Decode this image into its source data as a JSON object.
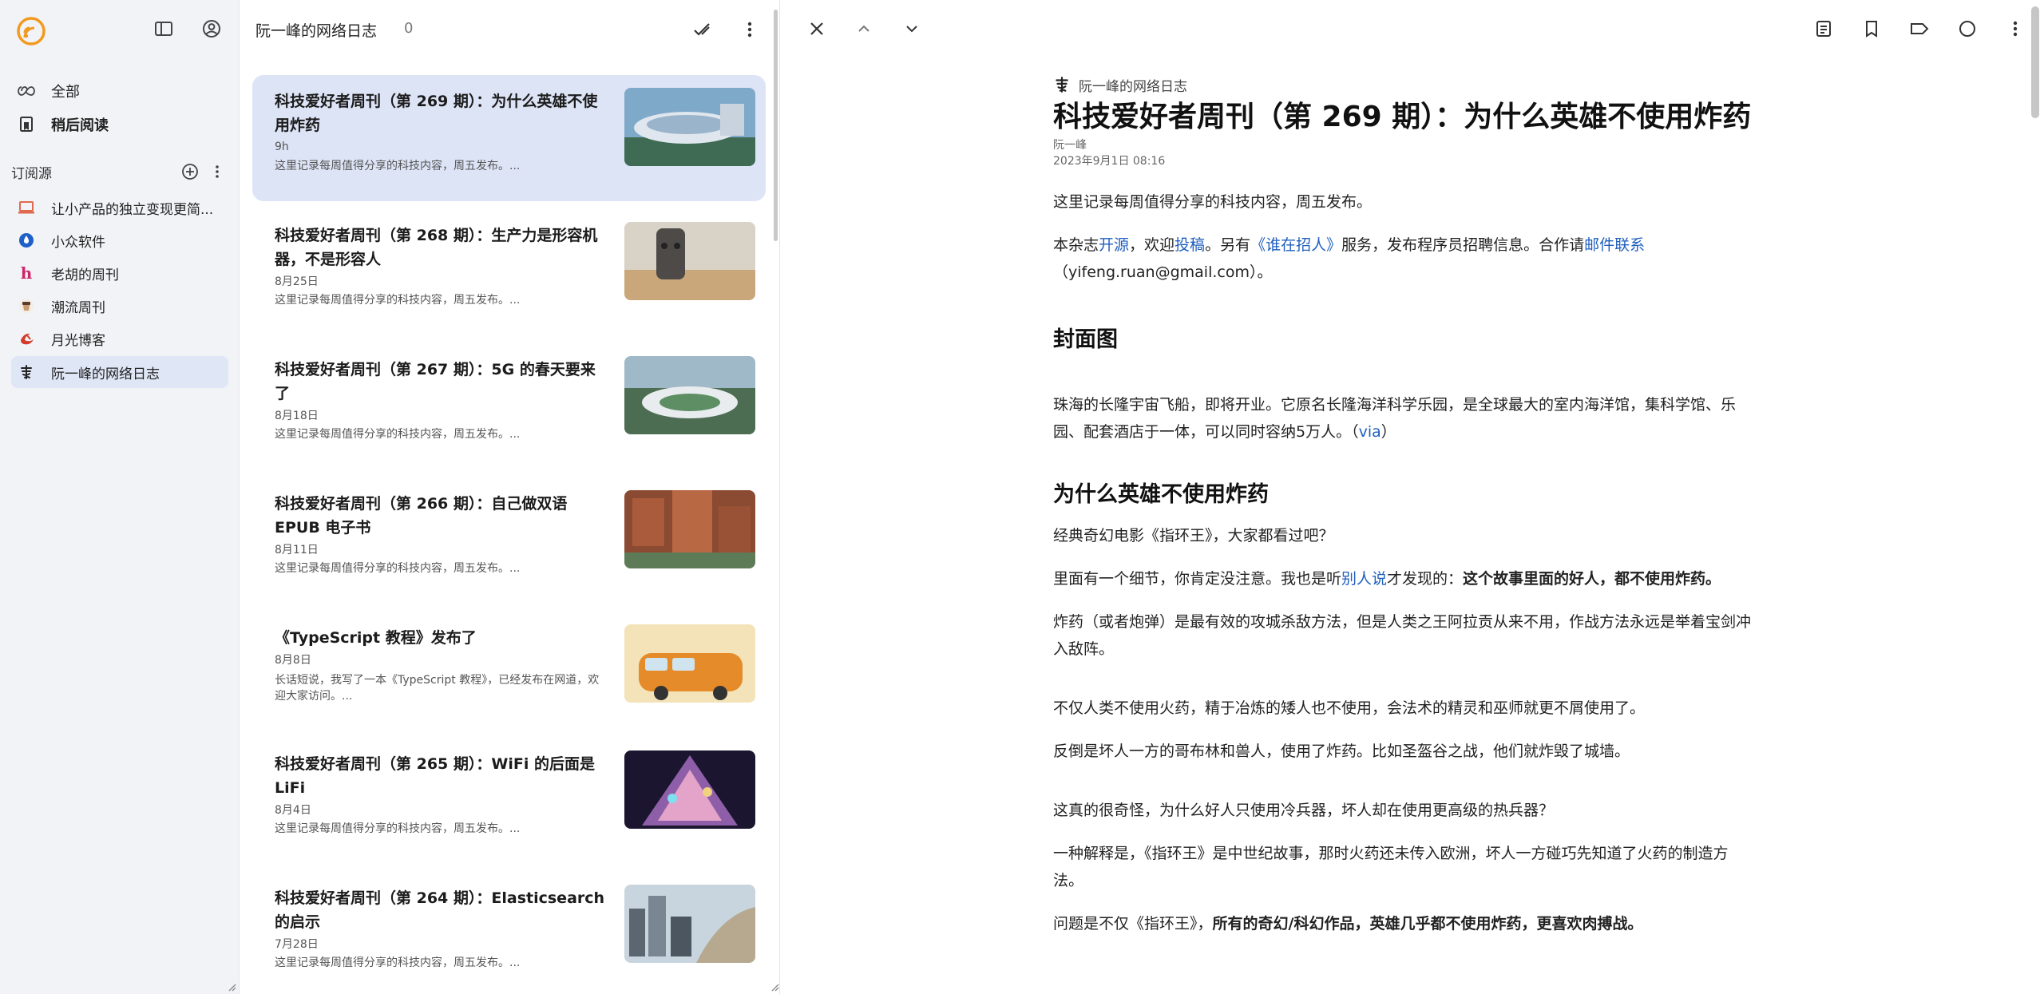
{
  "sidebar": {
    "nav": [
      {
        "label": "全部",
        "icon": "infinity-icon"
      },
      {
        "label": "稍后阅读",
        "icon": "read-later-icon"
      }
    ],
    "section_label": "订阅源",
    "feeds": [
      {
        "label": "让小产品的独立变现更简...",
        "icon": "laptop-favicon"
      },
      {
        "label": "小众软件",
        "icon": "drop-favicon"
      },
      {
        "label": "老胡的周刊",
        "icon": "h-favicon"
      },
      {
        "label": "潮流周刊",
        "icon": "cup-favicon"
      },
      {
        "label": "月光博客",
        "icon": "moon-favicon"
      },
      {
        "label": "阮一峰的网络日志",
        "icon": "calligraphy-favicon"
      }
    ]
  },
  "list": {
    "title": "阮一峰的网络日志",
    "count": "0",
    "cards": [
      {
        "title": "科技爱好者周刊（第 269 期）：为什么英雄不使用炸药",
        "date": "9h",
        "snippet": "这里记录每周值得分享的科技内容，周五发布。..."
      },
      {
        "title": "科技爱好者周刊（第 268 期）：生产力是形容机器，不是形容人",
        "date": "8月25日",
        "snippet": "这里记录每周值得分享的科技内容，周五发布。..."
      },
      {
        "title": "科技爱好者周刊（第 267 期）：5G 的春天要来了",
        "date": "8月18日",
        "snippet": "这里记录每周值得分享的科技内容，周五发布。..."
      },
      {
        "title": "科技爱好者周刊（第 266 期）：自己做双语 EPUB 电子书",
        "date": "8月11日",
        "snippet": "这里记录每周值得分享的科技内容，周五发布。..."
      },
      {
        "title": "《TypeScript 教程》发布了",
        "date": "8月8日",
        "snippet": "长话短说，我写了一本《TypeScript 教程》，已经发布在网道，欢迎大家访问。..."
      },
      {
        "title": "科技爱好者周刊（第 265 期）：WiFi 的后面是 LiFi",
        "date": "8月4日",
        "snippet": "这里记录每周值得分享的科技内容，周五发布。..."
      },
      {
        "title": "科技爱好者周刊（第 264 期）：Elasticsearch 的启示",
        "date": "7月28日",
        "snippet": "这里记录每周值得分享的科技内容，周五发布。..."
      }
    ]
  },
  "article": {
    "source": "阮一峰的网络日志",
    "title": "科技爱好者周刊（第 269 期）：为什么英雄不使用炸药",
    "author": "阮一峰",
    "datetime": "2023年9月1日 08:16",
    "p1": "这里记录每周值得分享的科技内容，周五发布。",
    "p2": {
      "t1": "本杂志",
      "l1": "开源",
      "t2": "，欢迎",
      "l2": "投稿",
      "t3": "。另有",
      "l3": "《谁在招人》",
      "t4": "服务，发布程序员招聘信息。合作请",
      "l4": "邮件联系",
      "t5": "（yifeng.ruan@gmail.com）。"
    },
    "h_cover": "封面图",
    "p3": "珠海的长隆宇宙飞船，即将开业。它原名长隆海洋科学乐园，是全球最大的室内海洋馆，集科学馆、乐园、配套酒店于一体，可以同时容纳5万人。（",
    "p3_link": "via",
    "p3_end": "）",
    "h_main": "为什么英雄不使用炸药",
    "p4": "经典奇幻电影《指环王》，大家都看过吧？",
    "p5": {
      "t1": "里面有一个细节，你肯定没注意。我也是听",
      "l1": "别人说",
      "t2": "才发现的：",
      "b1": "这个故事里面的好人，都不使用炸药。"
    },
    "p6": "炸药（或者炮弹）是最有效的攻城杀敌方法，但是人类之王阿拉贡从来不用，作战方法永远是举着宝剑冲入敌阵。",
    "p7": "不仅人类不使用火药，精于冶炼的矮人也不使用，会法术的精灵和巫师就更不屑使用了。",
    "p8": "反倒是坏人一方的哥布林和兽人，使用了炸药。比如圣盔谷之战，他们就炸毁了城墙。",
    "p9": "这真的很奇怪，为什么好人只使用冷兵器，坏人却在使用更高级的热兵器？",
    "p10": "一种解释是，《指环王》是中世纪故事，那时火药还未传入欧洲，坏人一方碰巧先知道了火药的制造方法。",
    "p11": {
      "t1": "问题是不仅《指环王》，",
      "b1": "所有的奇幻/科幻作品，英雄几乎都不使用炸药，更喜欢肉搏战。"
    }
  },
  "colors": {
    "accent": "#f29a1f",
    "link": "#1f5fbf",
    "active_bg": "#dde4f6"
  }
}
